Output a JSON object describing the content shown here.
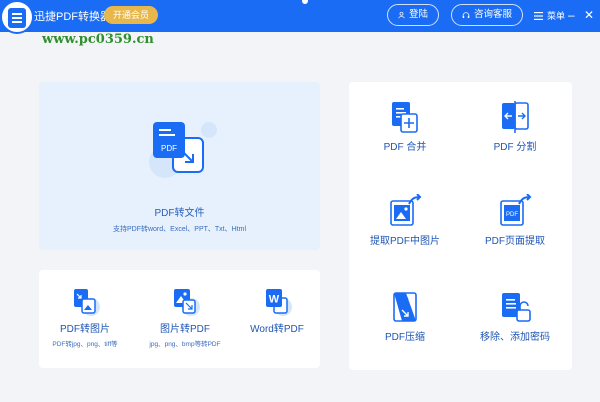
{
  "titlebar": {
    "app_title": "迅捷PDF转换器",
    "vip_label": "开通会员",
    "login_label": "登陆",
    "service_label": "咨询客服",
    "menu_label": "菜单",
    "minimize_glyph": "–",
    "close_glyph": "✕"
  },
  "watermark": "www.pc0359.cn",
  "hero": {
    "icon_text": "PDF",
    "title": "PDF转文件",
    "subtitle": "支持PDF转word、Excel、PPT、Txt、Html"
  },
  "bottom_tools": [
    {
      "label": "PDF转图片",
      "sub": "PDF转jpg、png、tiff等",
      "icon": "pdf-to-image-icon"
    },
    {
      "label": "图片转PDF",
      "sub": "jpg、png、bmp等转PDF",
      "icon": "image-to-pdf-icon"
    },
    {
      "label": "Word转PDF",
      "sub": "",
      "icon_text": "W",
      "icon": "word-to-pdf-icon"
    }
  ],
  "right_tools": [
    {
      "label": "PDF 合并",
      "icon": "pdf-merge-icon"
    },
    {
      "label": "PDF 分割",
      "icon": "pdf-split-icon"
    },
    {
      "label": "提取PDF中图片",
      "icon": "extract-image-icon"
    },
    {
      "label": "PDF页面提取",
      "icon_text": "PDF",
      "icon": "page-extract-icon"
    },
    {
      "label": "PDF压缩",
      "icon": "pdf-compress-icon"
    },
    {
      "label": "移除、添加密码",
      "icon": "password-icon"
    }
  ],
  "colors": {
    "primary": "#1a6cf5",
    "vip": "#e8b74c",
    "hero_bg": "#e6f1fd",
    "label": "#1f56b3",
    "background": "#f2f4f8"
  }
}
